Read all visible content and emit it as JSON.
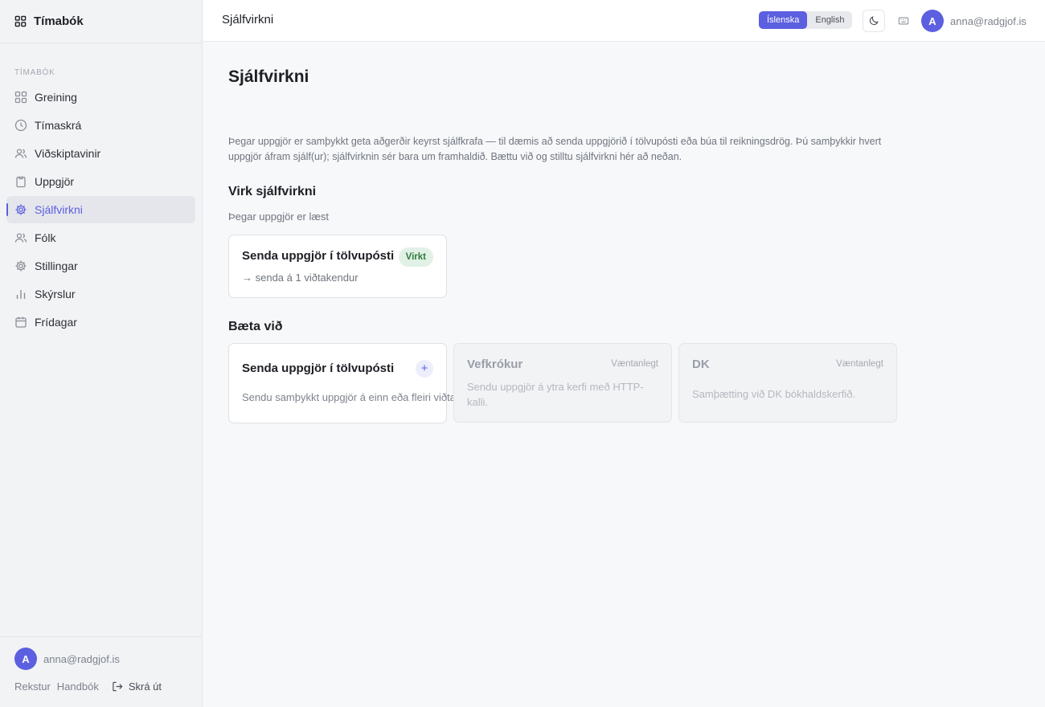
{
  "sidebar": {
    "brand": "Tímabók",
    "section_label": "TÍMABÓK",
    "items": [
      {
        "label": "Greining",
        "icon": "grid-icon"
      },
      {
        "label": "Tímaskrá",
        "icon": "clock-icon"
      },
      {
        "label": "Viðskiptavinir",
        "icon": "users-icon"
      },
      {
        "label": "Uppgjör",
        "icon": "clipboard-icon"
      },
      {
        "label": "Sjálfvirkni",
        "icon": "gear-icon",
        "active": true
      },
      {
        "label": "Fólk",
        "icon": "users-icon"
      },
      {
        "label": "Stillingar",
        "icon": "gear-icon"
      },
      {
        "label": "Skýrslur",
        "icon": "bar-chart-icon"
      },
      {
        "label": "Frídagar",
        "icon": "calendar-icon"
      }
    ],
    "footer": {
      "avatar_initial": "A",
      "email": "anna@radgjof.is",
      "links": [
        "Rekstur",
        "Handbók"
      ],
      "logout": "Skrá út"
    }
  },
  "header": {
    "title": "Sjálfvirkni",
    "languages": [
      "Íslenska",
      "English"
    ],
    "active_language": "Íslenska",
    "avatar_initial": "A",
    "email": "anna@radgjof.is"
  },
  "main": {
    "title": "Sjálfvirkni",
    "intro": "Þegar uppgjör er samþykkt geta aðgerðir keyrst sjálfkrafa — til dæmis að senda uppgjörið í tölvupósti eða búa til reikningsdrög. Þú samþykkir hvert uppgjör áfram sjálf(ur); sjálfvirknin sér bara um framhaldið. Bættu við og stilltu sjálfvirkni hér að neðan.",
    "active_section": {
      "title": "Virk sjálfvirkni",
      "trigger": "Þegar uppgjör er læst",
      "card": {
        "title": "Senda uppgjör í tölvupósti",
        "badge": "Virkt",
        "detail": "→ senda á 1 viðtakendur"
      }
    },
    "add_section": {
      "title": "Bæta við",
      "cards": [
        {
          "title": "Senda uppgjör í tölvupósti",
          "action": "+",
          "description": "Sendu samþykkt uppgjör á einn eða fleiri viðtakendur."
        },
        {
          "title": "Vefkrókur",
          "badge": "Væntanlegt",
          "description": "Sendu uppgjör á ytra kerfi með HTTP-kalli."
        },
        {
          "title": "DK",
          "badge": "Væntanlegt",
          "description": "Samþætting við DK bókhaldskerfið."
        }
      ]
    }
  },
  "colors": {
    "accent": "#5b5fe0",
    "success_bg": "#e2f1e5",
    "success_text": "#2f7a3e"
  }
}
